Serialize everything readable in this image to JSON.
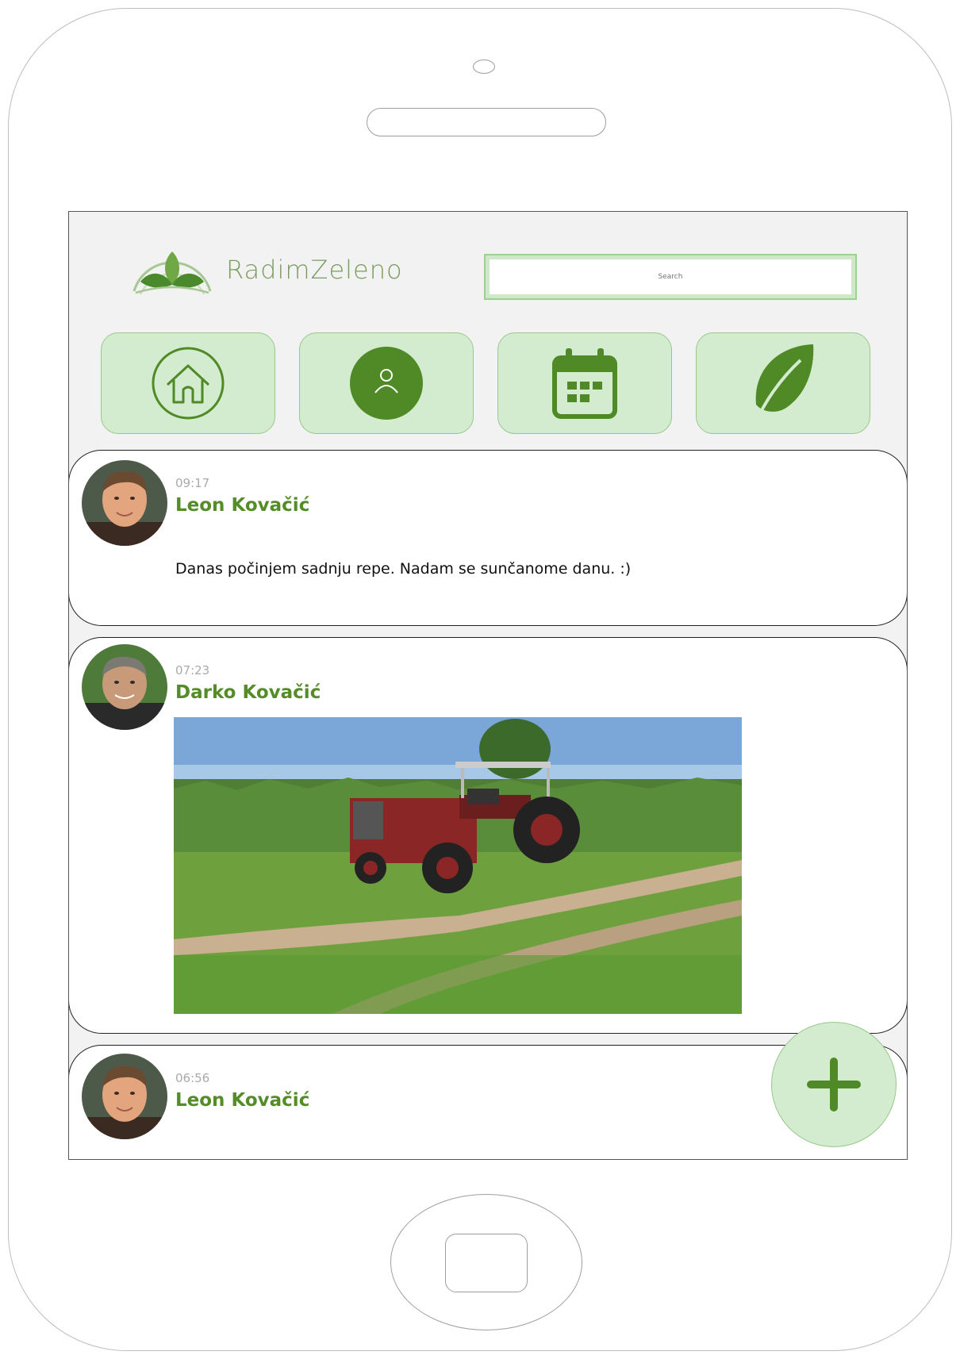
{
  "app": {
    "name": "RadimZeleno"
  },
  "search": {
    "placeholder": "Search"
  },
  "nav": {
    "items": [
      {
        "icon": "home-icon"
      },
      {
        "icon": "user-icon"
      },
      {
        "icon": "calendar-icon"
      },
      {
        "icon": "leaf-icon"
      }
    ]
  },
  "posts": [
    {
      "time": "09:17",
      "author": "Leon Kovačić",
      "text": "Danas počinjem sadnju repe. Nadam se sunčanome danu. :)"
    },
    {
      "time": "07:23",
      "author": "Darko Kovačić"
    },
    {
      "time": "06:56",
      "author": "Leon Kovačić"
    }
  ],
  "fab": {
    "icon": "plus-icon"
  },
  "colors": {
    "accent": "#548c28",
    "nav_bg": "#d3ebce",
    "nav_border": "#98c98a",
    "screen_bg": "#f2f2f2"
  }
}
